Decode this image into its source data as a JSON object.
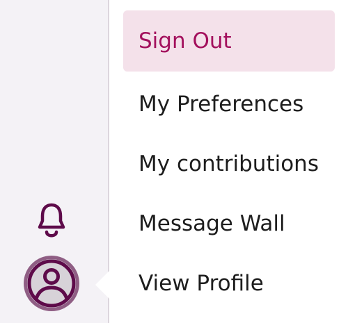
{
  "menu": {
    "items": [
      {
        "label": "Sign Out",
        "active": true
      },
      {
        "label": "My Preferences"
      },
      {
        "label": "My contributions"
      },
      {
        "label": "Message Wall"
      },
      {
        "label": "View Profile"
      }
    ]
  },
  "rail": {
    "notifications_icon": "bell-icon",
    "avatar_icon": "user-avatar-icon"
  },
  "colors": {
    "accent": "#a3105d",
    "icon": "#5e0b4a",
    "active_bg": "#f4e1ea",
    "rail_bg": "#f4f2f6"
  }
}
